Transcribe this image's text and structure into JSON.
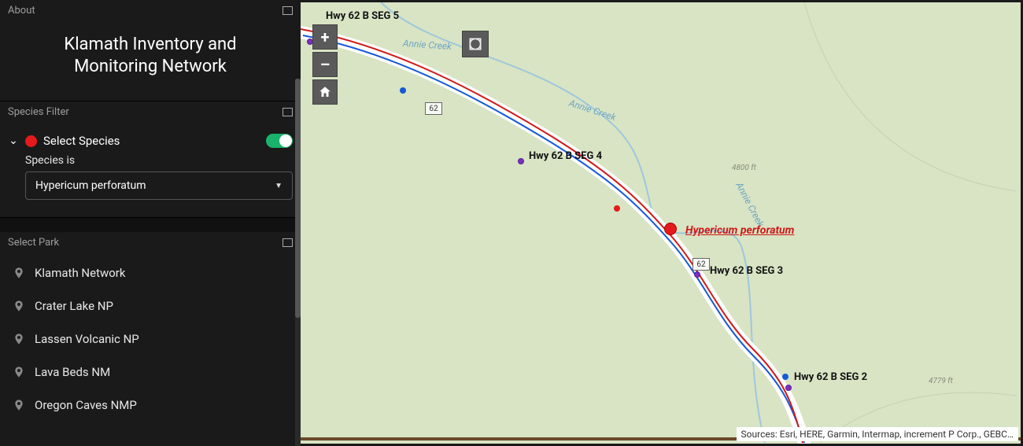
{
  "about": {
    "header": "About",
    "title": "Klamath Inventory and Monitoring Network"
  },
  "speciesFilter": {
    "header": "Species Filter",
    "row_label": "Select Species",
    "toggle_on": true,
    "sub_label": "Species is",
    "selected_value": "Hypericum perforatum"
  },
  "selectPark": {
    "header": "Select Park",
    "items": [
      "Klamath Network",
      "Crater Lake NP",
      "Lassen Volcanic NP",
      "Lava Beds NM",
      "Oregon Caves NMP"
    ]
  },
  "map": {
    "attribution": "Sources: Esri, HERE, Garmin, Intermap, increment P Corp., GEBC…",
    "hwy_number": "62",
    "creek_name": "Annie Creek",
    "species_callout": "Hypericum perforatum",
    "segments": {
      "s5": "Hwy 62 B SEG 5",
      "s4": "Hwy 62 B SEG 4",
      "s3": "Hwy 62 B SEG 3",
      "s2": "Hwy 62 B SEG 2"
    },
    "contours": {
      "c1": "4800 ft",
      "c2": "4779 ft"
    }
  }
}
